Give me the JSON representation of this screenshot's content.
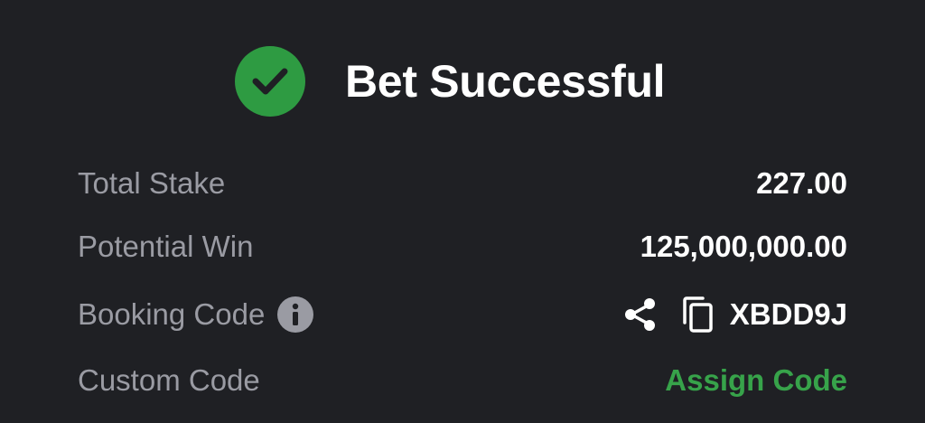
{
  "header": {
    "title": "Bet Successful",
    "icon": "check-circle-icon",
    "accent_color": "#2e9b42"
  },
  "rows": {
    "total_stake": {
      "label": "Total Stake",
      "value": "227.00"
    },
    "potential_win": {
      "label": "Potential Win",
      "value": "125,000,000.00"
    },
    "booking_code": {
      "label": "Booking Code",
      "value": "XBDD9J",
      "icons": [
        "info-icon",
        "share-icon",
        "copy-icon"
      ]
    },
    "custom_code": {
      "label": "Custom Code",
      "action": "Assign Code",
      "action_color": "#37a34a"
    }
  }
}
